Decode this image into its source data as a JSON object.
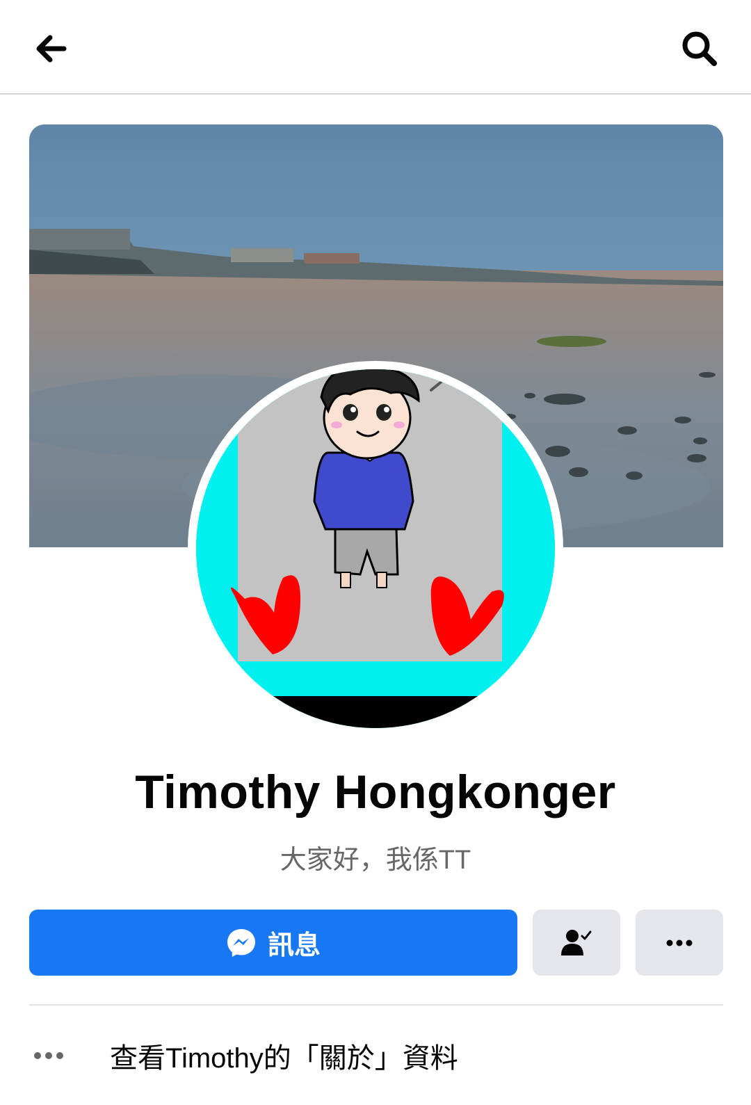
{
  "header": {
    "back_icon": "arrow-left-icon",
    "search_icon": "search-icon"
  },
  "profile": {
    "name": "Timothy Hongkonger",
    "bio": "大家好，我係TT"
  },
  "actions": {
    "message_label": "訊息",
    "message_icon": "messenger-icon",
    "friend_icon": "friend-check-icon",
    "more_icon": "more-horizontal-icon",
    "accent_color": "#1877f2"
  },
  "about": {
    "label": "查看Timothy的「關於」資料"
  }
}
